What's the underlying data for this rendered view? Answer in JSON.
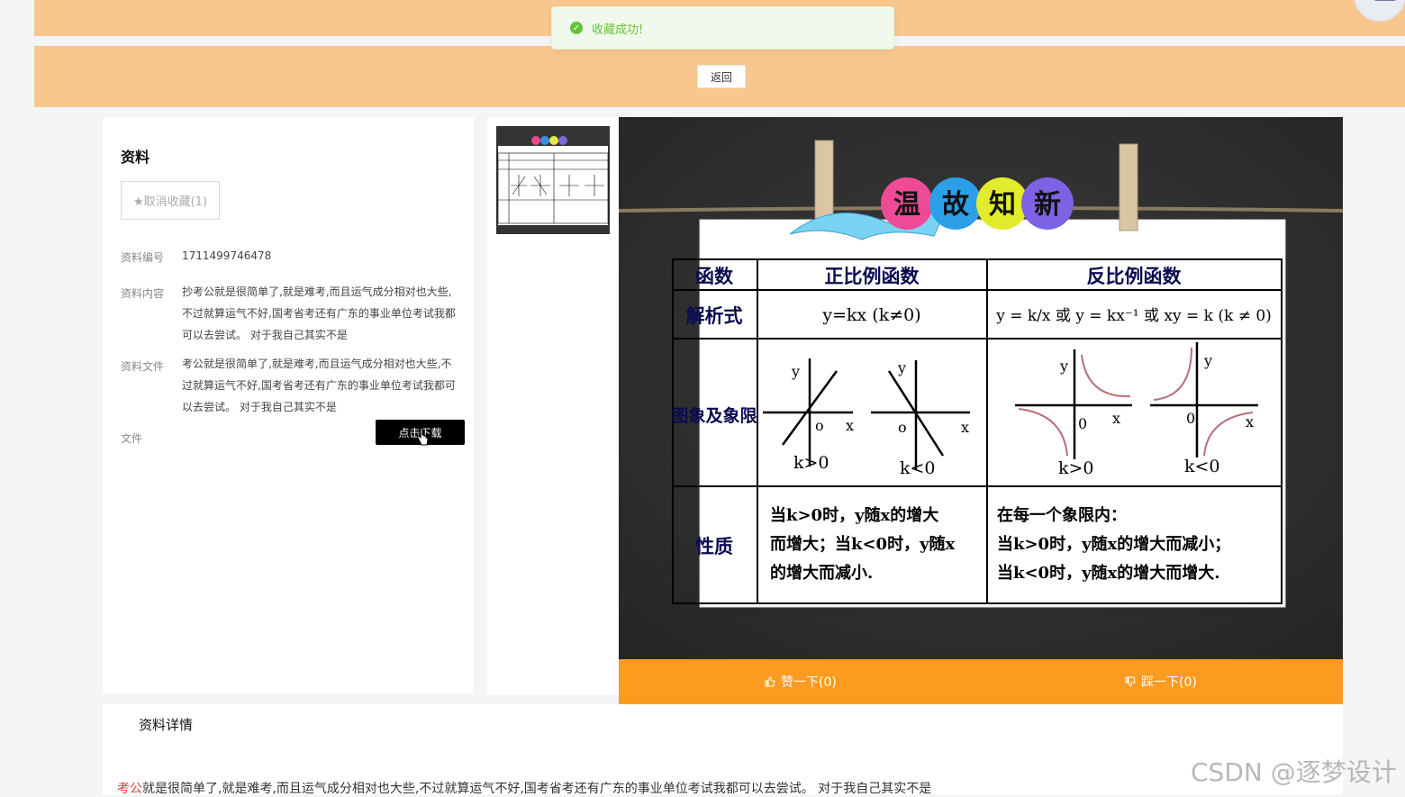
{
  "toast": {
    "message": "收藏成功!"
  },
  "header": {
    "back_label": "返回"
  },
  "resource": {
    "title": "资料",
    "favorite_button": "★取消收藏(1)",
    "fields": {
      "id_label": "资料编号",
      "id_value": "1711499746478",
      "content_label": "资料内容",
      "content_value": "抄考公就是很简单了,就是难考,而且运气成分相对也大些,不过就算运气不好,国考省考还有广东的事业单位考试我都可以去尝试。 对于我自己其实不是",
      "file_desc_label": "资料文件",
      "file_desc_value": "考公就是很简单了,就是难考,而且运气成分相对也大些,不过就算运气不好,国考省考还有广东的事业单位考试我都可以去尝试。 对于我自己其实不是",
      "file_label": "文件",
      "download_label": "点击下载"
    }
  },
  "slide": {
    "banner": [
      "温",
      "故",
      "知",
      "新"
    ],
    "table": {
      "headers": [
        "函数",
        "正比例函数",
        "反比例函数"
      ],
      "row_formula_label": "解析式",
      "direct_formula": "y=kx (k≠0)",
      "inverse_formula": "y = k/x 或 y = kx⁻¹ 或 xy = k (k ≠ 0)",
      "row_graph_label": "图象及象限",
      "graph_labels": [
        "k>0",
        "k<0",
        "k>0",
        "k<0"
      ],
      "axis_x": "x",
      "axis_y": "y",
      "origin_o": "o",
      "origin_0": "0",
      "row_property_label": "性质",
      "direct_property": [
        "当k>0时，y随x的增大",
        "而增大；当k<0时，y随x",
        "的增大而减小."
      ],
      "inverse_property": [
        "在每一个象限内：",
        "当k>0时，y随x的增大而减小；",
        "当k<0时，y随x的增大而增大."
      ]
    }
  },
  "votes": {
    "like": "赞一下(0)",
    "dislike": "踩一下(0)"
  },
  "details": {
    "title": "资料详情",
    "highlight": "考公",
    "text": "就是很简单了,就是难考,而且运气成分相对也大些,不过就算运气不好,国考省考还有广东的事业单位考试我都可以去尝试。 对于我自己其实不是"
  },
  "watermark": "CSDN @逐梦设计",
  "colors": {
    "band": "#f9c78d",
    "vote_bar": "#fb9b20",
    "toast_green": "#67c23a",
    "download_btn": "#000000"
  }
}
